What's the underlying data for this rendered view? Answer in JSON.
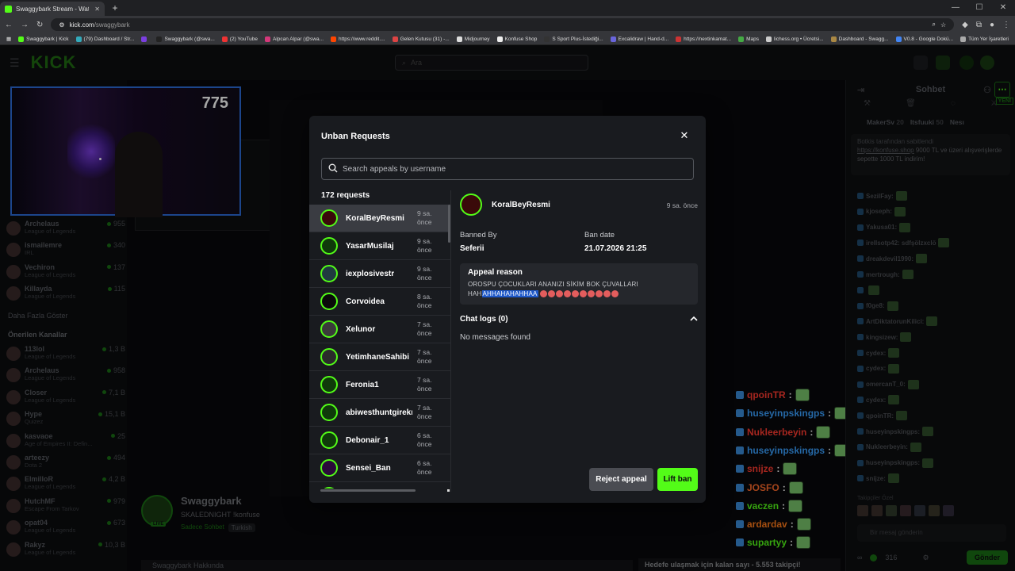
{
  "browser": {
    "tab_title": "Swaggybark Stream - Watch Li",
    "url_host": "kick.com",
    "url_path": "/swaggybark",
    "bookmarks": [
      "Swaggybark | Kick",
      "(79) Dashboard / Str...",
      "",
      "Swaggybark (@swa...",
      "(2) YouTube",
      "Alpcan Alpar (@swa...",
      "https://www.reddit....",
      "Gelen Kutusu (31) -...",
      "Midjourney",
      "Konfuse Shop",
      "S Sport Plus-İstediği...",
      "Excalidraw | Hand-d...",
      "https://nextinkamat...",
      "Maps",
      "lichess.org • Ücretsi...",
      "Dashboard - Swagg...",
      "V0.8 - Google Dokü...",
      "Tüm Yer İşaretleri"
    ]
  },
  "kick": {
    "logo": "KICK",
    "search_placeholder": "Ara"
  },
  "sidebar": {
    "top_items": [
      {
        "name": "Archelaus",
        "sub": "League of Legends",
        "viewers": "955"
      },
      {
        "name": "ismailemre",
        "sub": "IRL",
        "viewers": "340"
      },
      {
        "name": "Vechiron",
        "sub": "League of Legends",
        "viewers": "137"
      },
      {
        "name": "Killayda",
        "sub": "League of Legends",
        "viewers": "115"
      }
    ],
    "show_more": "Daha Fazla Göster",
    "recommended_heading": "Önerilen Kanallar",
    "recommended": [
      {
        "name": "113lol",
        "sub": "League of Legends",
        "viewers": "1,3 B"
      },
      {
        "name": "Archelaus",
        "sub": "League of Legends",
        "viewers": "958"
      },
      {
        "name": "Closer",
        "sub": "League of Legends",
        "viewers": "7,1 B"
      },
      {
        "name": "Hype",
        "sub": "Quizez",
        "viewers": "15,1 B"
      },
      {
        "name": "kasvaoe",
        "sub": "Age of Empires II: Defin...",
        "viewers": "25"
      },
      {
        "name": "arteezy",
        "sub": "Dota 2",
        "viewers": "494"
      },
      {
        "name": "ElmilloR",
        "sub": "League of Legends",
        "viewers": "4,2 B"
      },
      {
        "name": "HutchMF",
        "sub": "Escape From Tarkov",
        "viewers": "979"
      },
      {
        "name": "opat04",
        "sub": "League of Legends",
        "viewers": "673"
      },
      {
        "name": "Rakyz",
        "sub": "League of Legends",
        "viewers": "10,3 B"
      }
    ]
  },
  "stream": {
    "pip_counter": "775",
    "ghost_counter": "775",
    "streamer_name": "Swaggybark",
    "live": "LIVE",
    "title": "SKALEDNIGHT !konfuse",
    "mode": "Sadece Sohbet",
    "language": "Turkish",
    "about": "Swaggybark Hakkında",
    "goal": "Hedefe ulaşmak için kalan sayı - 5.553 takipçi!"
  },
  "overlay_chat": [
    {
      "user": "qpoinTR",
      "color": "#ff3b30"
    },
    {
      "user": "huseyinpskingps",
      "color": "#3aa0ff"
    },
    {
      "user": "Nukleerbeyin",
      "color": "#ff3b30"
    },
    {
      "user": "huseyinpskingps",
      "color": "#3aa0ff"
    },
    {
      "user": "snijze",
      "color": "#ff3b30"
    },
    {
      "user": "JOSFO",
      "color": "#ff6b2b"
    },
    {
      "user": "vaczen",
      "color": "#53fc18"
    },
    {
      "user": "ardardav",
      "color": "#ff7a1a"
    },
    {
      "user": "supartyy",
      "color": "#53fc18"
    }
  ],
  "chat": {
    "title": "Sohbet",
    "new_badge": "YENİ",
    "gifters": [
      "MakerSv",
      "Itsfuuki",
      "Nesı"
    ],
    "gifter_counts": [
      "20",
      "50",
      ""
    ],
    "pinned_by": "Botkis tarafından sabitlendi",
    "pinned_link": "https://konfuse.shop",
    "pinned_text": "9000 TL ve üzeri alışverişlerde sepette 1000 TL indirim!",
    "messages": [
      "SezilFay:",
      "kjoseph:",
      "Yakusa01:",
      "irellsotp42: sdfşölzxclö",
      "dreakdevil1990:",
      "mertrough:",
      "",
      "f0ge8:",
      "ArtDiktatorunKilici:",
      "kingsizew:",
      "cydex:",
      "cydex:",
      "omercanT_0:",
      "cydex:",
      "qpoinTR:",
      "huseyinpskingps:",
      "Nukleerbeyin:",
      "huseyinpskingps:",
      "snijze:"
    ],
    "emote_bar": "Takipçiler Özel",
    "input_placeholder": "Bir mesaj gönderin",
    "points": "316",
    "send": "Gönder"
  },
  "modal": {
    "title": "Unban Requests",
    "search_placeholder": "Search appeals by username",
    "count": "172 requests",
    "requests": [
      {
        "name": "KoralBeyResmi",
        "time": "9 sa. önce",
        "active": true
      },
      {
        "name": "YasarMusilaj",
        "time": "9 sa. önce"
      },
      {
        "name": "iexplosivestr",
        "time": "9 sa. önce"
      },
      {
        "name": "Corvoidea",
        "time": "8 sa. önce"
      },
      {
        "name": "Xelunor",
        "time": "7 sa. önce"
      },
      {
        "name": "YetimhaneSahibi",
        "time": "7 sa. önce"
      },
      {
        "name": "Feronia1",
        "time": "7 sa. önce"
      },
      {
        "name": "abiwesthuntgirekmi",
        "time": "7 sa. önce"
      },
      {
        "name": "Debonair_1",
        "time": "6 sa. önce"
      },
      {
        "name": "Sensei_Ban",
        "time": "6 sa. önce"
      }
    ],
    "detail": {
      "username": "KoralBeyResmi",
      "time": "9 sa. önce",
      "banned_by_label": "Banned By",
      "banned_by": "Seferii",
      "ban_date_label": "Ban date",
      "ban_date": "21.07.2026 21:25",
      "appeal_label": "Appeal reason",
      "appeal_line1": "OROSPU ÇOCUKLARI ANANIZI SİKİM BOK ÇUVALLARI",
      "appeal_line2_plain": "HAH",
      "appeal_line2_selected": "AHHAHAHAHHAA",
      "chatlogs_label": "Chat logs (0)",
      "no_messages": "No messages found"
    },
    "reject_label": "Reject appeal",
    "lift_label": "Lift ban"
  }
}
